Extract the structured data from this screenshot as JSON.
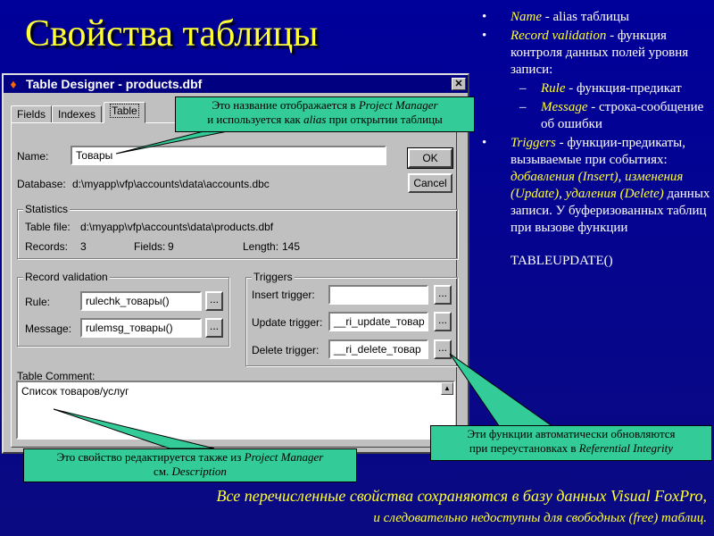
{
  "slide": {
    "title": "Свойства таблицы",
    "footer_line1": "Все перечисленные свойства сохраняются в базу данных Visual FoxPro,",
    "footer_line2": "и следовательно недоступны для свободных (free) таблиц.",
    "colors": {
      "background": "#0a0a8e",
      "title": "#ffff33",
      "callout": "#33cc99"
    }
  },
  "bullets": {
    "name_term": "Name",
    "name_desc": " - alias таблицы",
    "rv_term": "Record validation",
    "rv_desc": " - функция контроля данных полей уровня записи:",
    "rule_term": "Rule",
    "rule_desc": " - функция-предикат",
    "msg_term": "Message",
    "msg_desc": " - строка-сообщение об ошибки",
    "trig_term": "Triggers",
    "trig_desc1": " - функции-предикаты, вызываемые при событиях: ",
    "trig_add": "добавления (Insert)",
    "trig_sep1": ", ",
    "trig_upd": "изменения (Update)",
    "trig_sep2": ", ",
    "trig_del": "удаления (Delete)",
    "trig_desc2": " данных записи. У буферизованных таблиц  при вызове функции",
    "tableupdate": "TABLEUPDATE()"
  },
  "window": {
    "title": "Table Designer - products.dbf",
    "close_glyph": "✕",
    "app_icon": "fox-icon",
    "tabs": [
      "Fields",
      "Indexes",
      "Table"
    ],
    "active_tab": "Table",
    "name_label": "Name:",
    "name_value": "Товары",
    "ok_label": "OK",
    "cancel_label": "Cancel",
    "database_label": "Database:",
    "database_value": "d:\\myapp\\vfp\\accounts\\data\\accounts.dbc",
    "statistics": {
      "group_title": "Statistics",
      "table_file_label": "Table file:",
      "table_file_value": "d:\\myapp\\vfp\\accounts\\data\\products.dbf",
      "records_label": "Records:",
      "records_value": "3",
      "fields_label": "Fields:",
      "fields_value": "9",
      "length_label": "Length:",
      "length_value": "145"
    },
    "record_validation": {
      "group_title": "Record validation",
      "rule_label": "Rule:",
      "rule_value": "rulechk_товары()",
      "message_label": "Message:",
      "message_value": "rulemsg_товары()",
      "dots": "..."
    },
    "triggers": {
      "group_title": "Triggers",
      "insert_label": "Insert trigger:",
      "insert_value": "",
      "update_label": "Update trigger:",
      "update_value": "__ri_update_товар",
      "delete_label": "Delete trigger:",
      "delete_value": "__ri_delete_товар",
      "dots": "..."
    },
    "comment_label": "Table Comment:",
    "comment_value": "Список товаров/услуг"
  },
  "callouts": {
    "top_line1_pre": "Это название отображается в ",
    "top_line1_em": "Project Manager",
    "top_line2_pre": "и используется как ",
    "top_line2_em": "alias",
    "top_line2_post": " при открытии таблицы",
    "bottom_line1_pre": "Это свойство редактируется также из ",
    "bottom_line1_em": "Project Manager",
    "bottom_line2_pre": "см. ",
    "bottom_line2_em": "Description",
    "right_line1": "Эти функции автоматически обновляются",
    "right_line2_pre": "при переустановках в ",
    "right_line2_em": "Referential Integrity"
  }
}
